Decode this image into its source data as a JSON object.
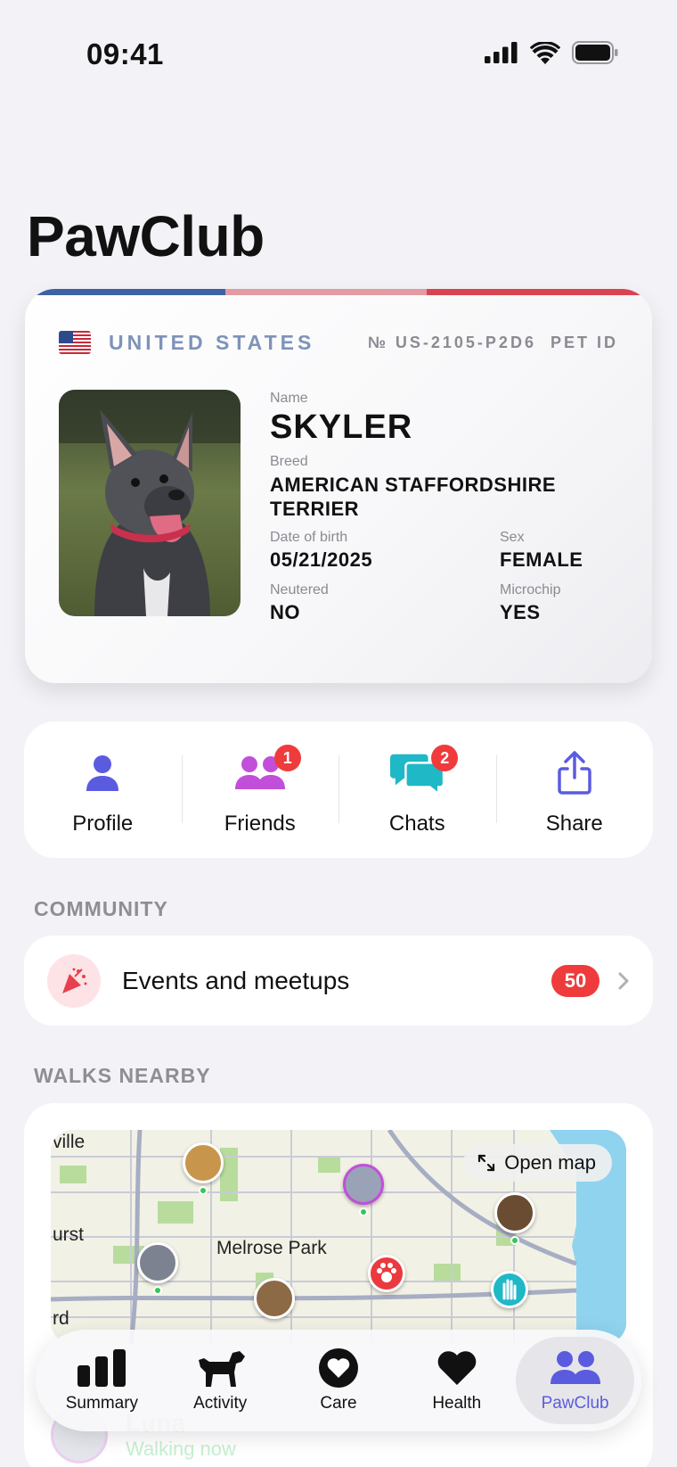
{
  "status_bar": {
    "time": "09:41"
  },
  "page_title": "PawClub",
  "id_card": {
    "country": "UNITED STATES",
    "number": "№ US-2105-P2D6",
    "card_type": "PET ID",
    "flag_colors": [
      "#3d62a4",
      "#e39aa1",
      "#d94450"
    ],
    "fields": {
      "name_label": "Name",
      "name": "SKYLER",
      "breed_label": "Breed",
      "breed": "AMERICAN STAFFORDSHIRE TERRIER",
      "dob_label": "Date of birth",
      "dob": "05/21/2025",
      "sex_label": "Sex",
      "sex": "FEMALE",
      "neutered_label": "Neutered",
      "neutered": "NO",
      "microchip_label": "Microchip",
      "microchip": "YES"
    }
  },
  "actions": [
    {
      "label": "Profile",
      "icon": "person-icon",
      "color": "#5b5be0",
      "badge": ""
    },
    {
      "label": "Friends",
      "icon": "people-icon",
      "color": "#c24fd9",
      "badge": "1"
    },
    {
      "label": "Chats",
      "icon": "chat-bubbles-icon",
      "color": "#1fb8c7",
      "badge": "2"
    },
    {
      "label": "Share",
      "icon": "share-icon",
      "color": "#5b5be0",
      "badge": ""
    }
  ],
  "community": {
    "section_title": "COMMUNITY",
    "events_label": "Events and meetups",
    "events_count": "50"
  },
  "walks": {
    "section_title": "WALKS NEARBY",
    "open_map_label": "Open map",
    "map_labels": [
      "ville",
      "urst",
      "Melrose Park",
      "rd"
    ],
    "nearby_name": "Luna",
    "nearby_status": "Walking now"
  },
  "tabs": [
    {
      "label": "Summary",
      "icon": "bar-chart-icon",
      "active": false
    },
    {
      "label": "Activity",
      "icon": "dog-icon",
      "active": false
    },
    {
      "label": "Care",
      "icon": "heart-circle-icon",
      "active": false
    },
    {
      "label": "Health",
      "icon": "heart-icon",
      "active": false
    },
    {
      "label": "PawClub",
      "icon": "people-icon",
      "active": true
    }
  ],
  "accent": "#5b5be0"
}
